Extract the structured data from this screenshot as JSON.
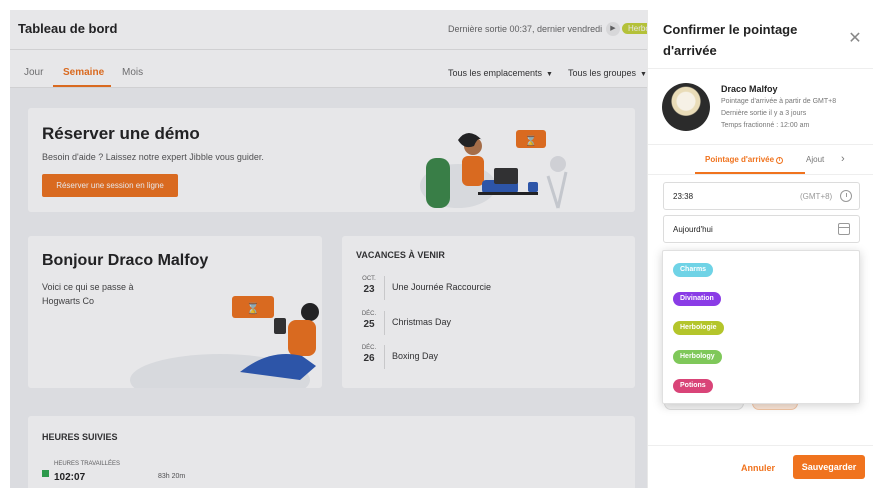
{
  "dashboard": {
    "title": "Tableau de bord",
    "last_exit": "Dernière sortie 00:37, dernier vendredi",
    "status_chip": "Herbo",
    "tabs": [
      {
        "label": "Jour",
        "active": false
      },
      {
        "label": "Semaine",
        "active": true
      },
      {
        "label": "Mois",
        "active": false
      }
    ],
    "filters": {
      "locations": "Tous les emplacements",
      "groups": "Tous les groupes"
    },
    "demo_card": {
      "title": "Réserver une démo",
      "subtitle": "Besoin d'aide ? Laissez notre expert Jibble vous guider.",
      "button": "Réserver une session en ligne"
    },
    "greeting_card": {
      "title": "Bonjour Draco Malfoy",
      "subtitle": "Voici ce qui se passe à Hogwarts Co"
    },
    "holidays": {
      "title": "VACANCES À VENIR",
      "items": [
        {
          "month": "OCT.",
          "day": "23",
          "name": "Une Journée Raccourcie"
        },
        {
          "month": "DÉC.",
          "day": "25",
          "name": "Christmas Day"
        },
        {
          "month": "DÉC.",
          "day": "26",
          "name": "Boxing Day"
        }
      ]
    },
    "hours": {
      "title": "HEURES SUIVIES",
      "label": "HEURES TRAVAILLÉES",
      "value": "102:07",
      "extra": "83h 20m"
    }
  },
  "panel": {
    "title": "Confirmer le pointage d'arrivée",
    "user": {
      "name": "Draco Malfoy",
      "line1": "Pointage d'arrivée à partir de GMT+8",
      "line2": "Dernière sortie il y a 3 jours",
      "line3": "Temps fractionné : 12:00 am"
    },
    "tabs": [
      {
        "label": "Pointage d'arrivée",
        "active": true
      },
      {
        "label": "Ajout",
        "active": false
      }
    ],
    "time_field": {
      "value": "23:38",
      "timezone": "(GMT+8)"
    },
    "date_field": {
      "value": "Aujourd'hui"
    },
    "cancel_label": "Annuler",
    "save_label": "Sauvegarder"
  },
  "dropdown": {
    "items": [
      {
        "label": "Charms",
        "color": "#6fd3e6"
      },
      {
        "label": "Divination",
        "color": "#8a3ce6"
      },
      {
        "label": "Herbologie",
        "color": "#b4c52b"
      },
      {
        "label": "Herbology",
        "color": "#7fc85a"
      },
      {
        "label": "Potions",
        "color": "#d94478"
      }
    ]
  },
  "colors": {
    "accent": "#f0731e"
  }
}
